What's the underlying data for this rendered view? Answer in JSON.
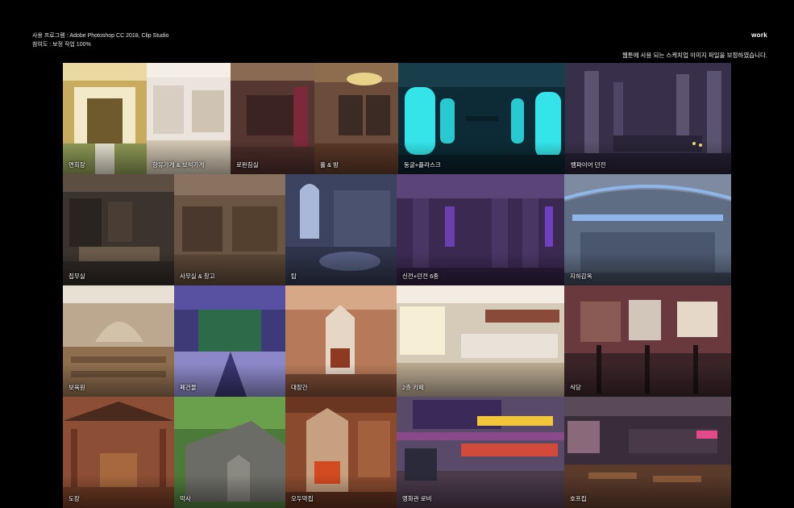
{
  "header": {
    "program_line": "사용 프로그램 : Adobe Photoshop CC 2018, Clip Studio",
    "participation_line": "참여도 : 보정 작업 100%",
    "work_label": "work",
    "description": "웹툰에 사용 되는 스케치업 이미지 파일을 보정하였습니다."
  },
  "tiles": [
    {
      "label": "연회장",
      "bg": "#c9b673"
    },
    {
      "label": "향유가게 & 보석가게",
      "bg": "#e7e1d8"
    },
    {
      "label": "로판침실",
      "bg": "#5a3b34"
    },
    {
      "label": "홀 & 방",
      "bg": "#6d4e3c"
    },
    {
      "label": "동굴+플라스크",
      "bg": "#0e3440"
    },
    {
      "label": "뱀파이어 던전",
      "bg": "#3a3248"
    },
    {
      "label": "집무실",
      "bg": "#3c3530"
    },
    {
      "label": "사무실 & 창고",
      "bg": "#6c5646"
    },
    {
      "label": "탑",
      "bg": "#3e4560"
    },
    {
      "label": "신전+던전 6종",
      "bg": "#3e2a55"
    },
    {
      "label": "지하감옥",
      "bg": "#5f6e86"
    },
    {
      "label": "보육원",
      "bg": "#b9a68d"
    },
    {
      "label": "폐건물",
      "bg": "#3d3a78"
    },
    {
      "label": "대장간",
      "bg": "#b77a5b"
    },
    {
      "label": "2층 카페",
      "bg": "#d5cabb"
    },
    {
      "label": "식당",
      "bg": "#6a3a3e"
    },
    {
      "label": "도장",
      "bg": "#8d4e34"
    },
    {
      "label": "막사",
      "bg": "#4b6b3a"
    },
    {
      "label": "오두막집",
      "bg": "#8a4a2e"
    },
    {
      "label": "영화관 로비",
      "bg": "#5a4a6a"
    },
    {
      "label": "호프집",
      "bg": "#3b2e3a"
    }
  ]
}
